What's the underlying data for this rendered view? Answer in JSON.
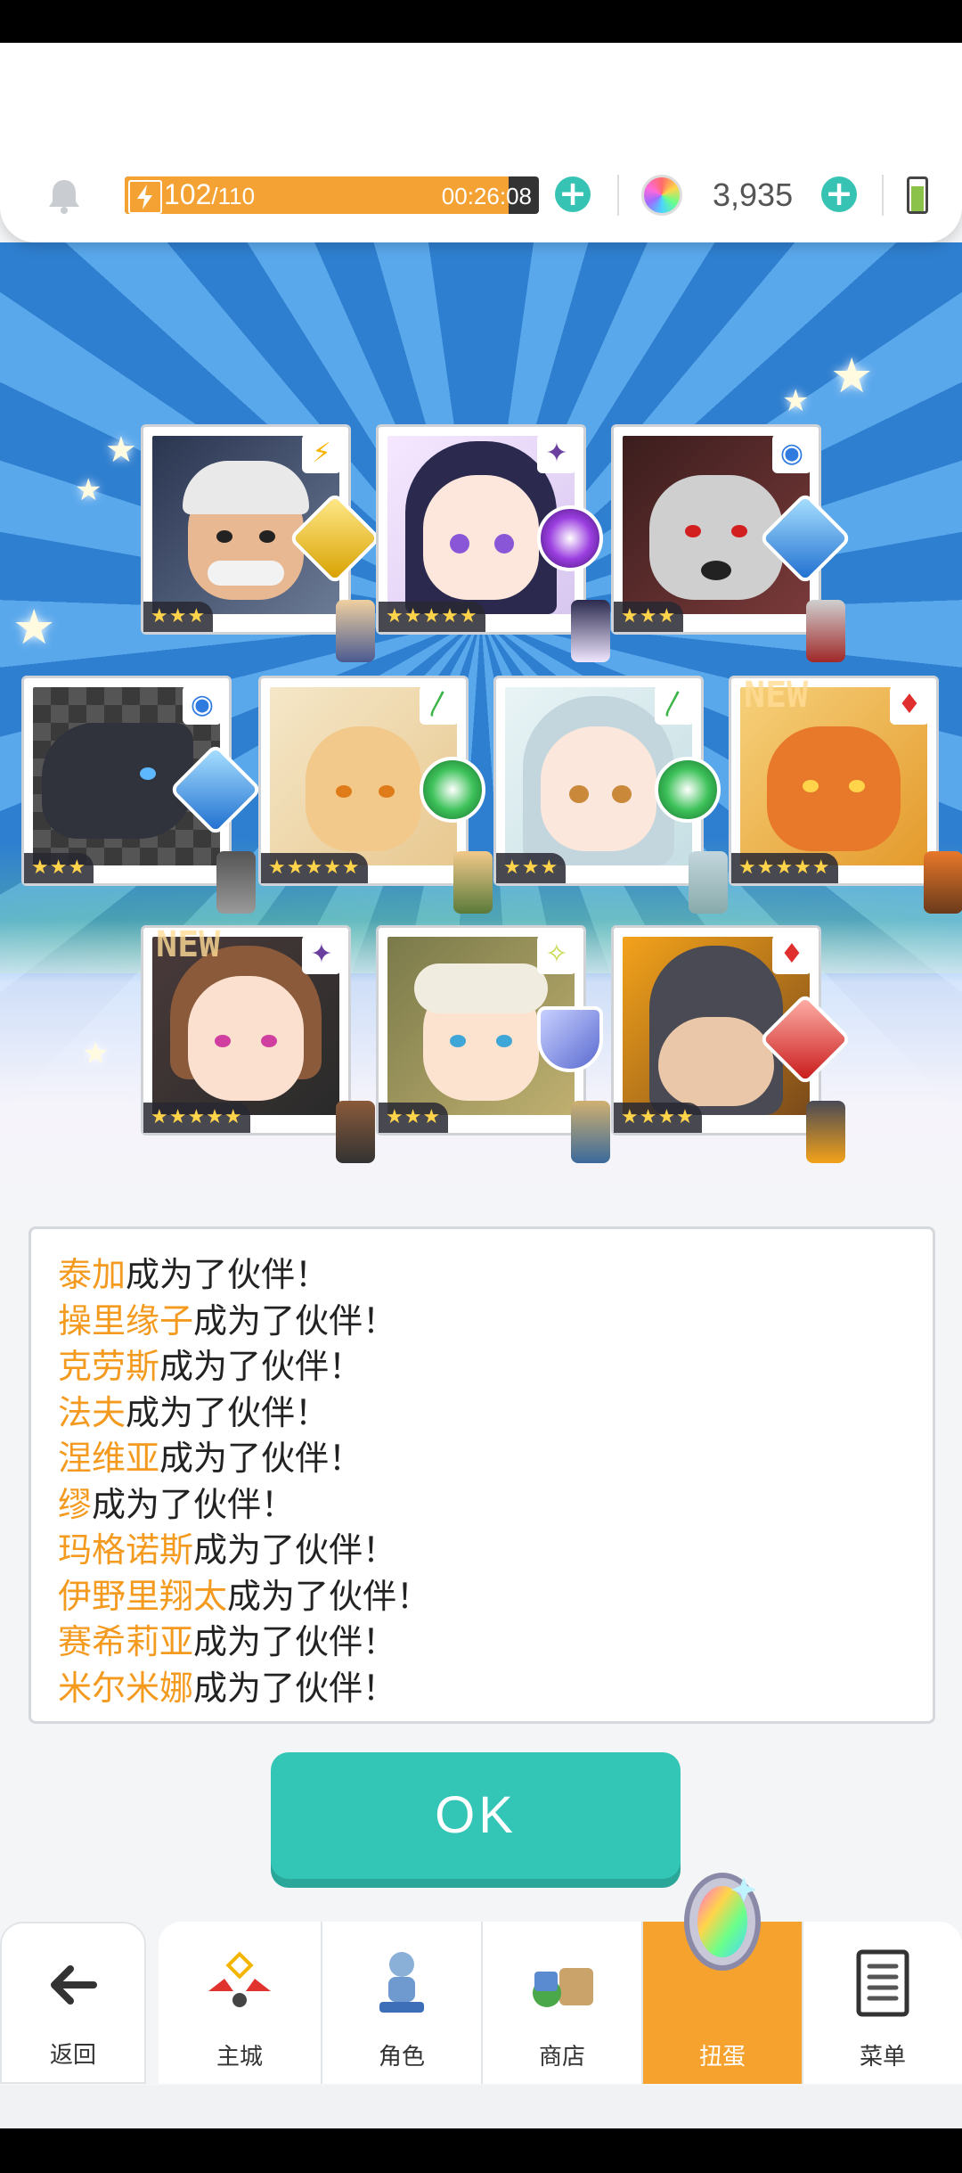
{
  "topbar": {
    "stamina_current": "102",
    "stamina_max": "/110",
    "stamina_fraction": 0.927,
    "timer": "00:26:08",
    "gems": "3,935",
    "icons": [
      "bell-icon",
      "bolt-icon",
      "plus-icon",
      "gem-icon",
      "battery-icon"
    ]
  },
  "cards": [
    {
      "rarity": "★★★",
      "element": "lightning",
      "new": false
    },
    {
      "rarity": "★★★★★",
      "element": "dark",
      "new": false
    },
    {
      "rarity": "★★★",
      "element": "water",
      "new": false
    },
    {
      "rarity": "★★★",
      "element": "water",
      "new": false
    },
    {
      "rarity": "★★★★★",
      "element": "wind",
      "new": false
    },
    {
      "rarity": "★★★",
      "element": "wind",
      "new": false
    },
    {
      "rarity": "★★★★★",
      "element": "fire",
      "new": true,
      "new_label": "NEW"
    },
    {
      "rarity": "★★★★★",
      "element": "dark",
      "new": true,
      "new_label": "NEW"
    },
    {
      "rarity": "★★★",
      "element": "light",
      "new": false
    },
    {
      "rarity": "★★★★",
      "element": "fire",
      "new": false
    }
  ],
  "messages": [
    {
      "name": "泰加",
      "suffix": "成为了伙伴！"
    },
    {
      "name": "操里缘子",
      "suffix": "成为了伙伴！"
    },
    {
      "name": "克劳斯",
      "suffix": "成为了伙伴！"
    },
    {
      "name": "法夫",
      "suffix": "成为了伙伴！"
    },
    {
      "name": "涅维亚",
      "suffix": "成为了伙伴！"
    },
    {
      "name": "缪",
      "suffix": "成为了伙伴！"
    },
    {
      "name": "玛格诺斯",
      "suffix": "成为了伙伴！"
    },
    {
      "name": "伊野里翔太",
      "suffix": "成为了伙伴！"
    },
    {
      "name": "赛希莉亚",
      "suffix": "成为了伙伴！"
    },
    {
      "name": "米尔米娜",
      "suffix": "成为了伙伴！"
    }
  ],
  "ok_label": "OK",
  "nav": {
    "back": "返回",
    "main": "主城",
    "character": "角色",
    "shop": "商店",
    "gacha": "扭蛋",
    "menu": "菜单"
  },
  "colors": {
    "accent": "#33c6b6",
    "highlight": "#f39a1f",
    "stamina": "#f4a233",
    "nav_active": "#f6a22e"
  }
}
